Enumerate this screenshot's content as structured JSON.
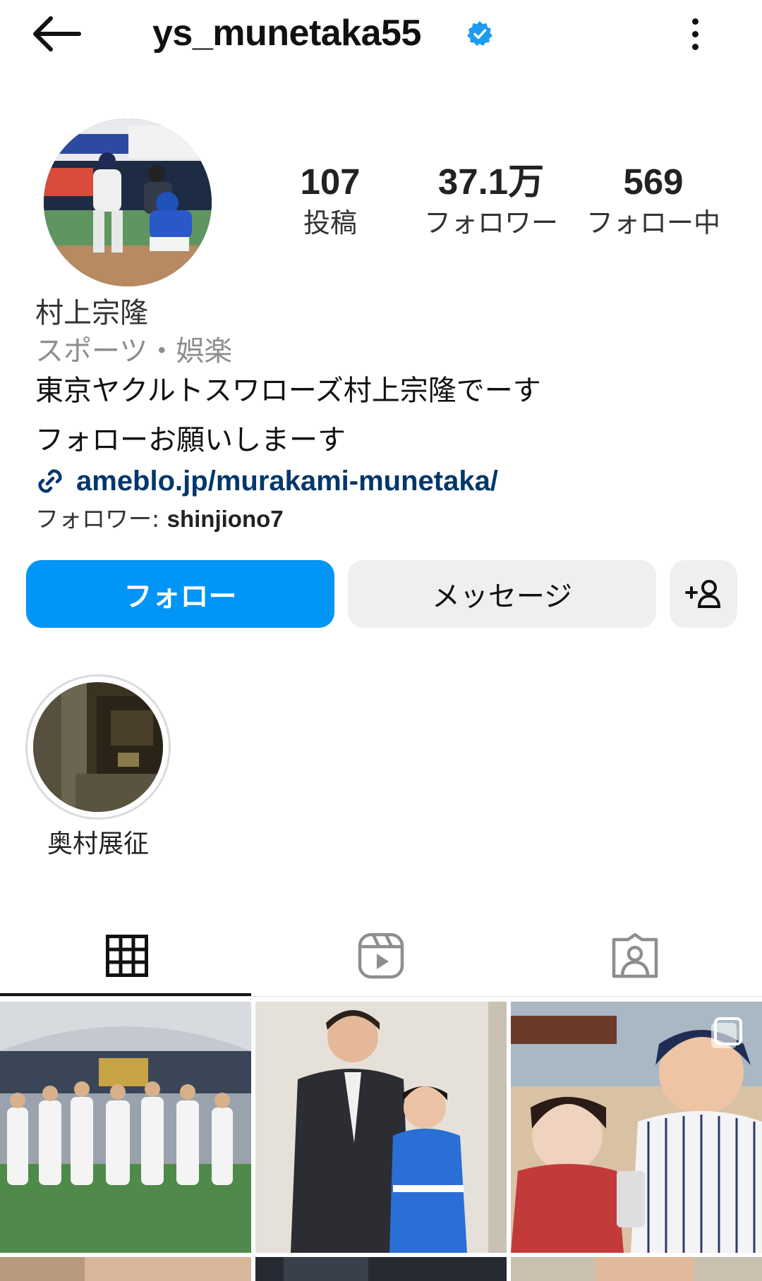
{
  "header": {
    "username": "ys_munetaka55"
  },
  "stats": [
    {
      "value": "107",
      "label": "投稿"
    },
    {
      "value": "37.1万",
      "label": "フォロワー"
    },
    {
      "value": "569",
      "label": "フォロー中"
    }
  ],
  "profile": {
    "name": "村上宗隆",
    "category": "スポーツ・娯楽",
    "bio_line1": "東京ヤクルトスワローズ村上宗隆でーす",
    "bio_line2": "フォローお願いしまーす",
    "link": "ameblo.jp/murakami-munetaka/",
    "followed_by_prefix": "フォロワー: ",
    "followed_by_user": "shinjiono7"
  },
  "actions": {
    "follow_label": "フォロー",
    "message_label": "メッセージ"
  },
  "highlights": [
    {
      "label": "奥村展征"
    }
  ],
  "tabs": [
    {
      "name": "posts",
      "icon": "grid-icon",
      "active": true
    },
    {
      "name": "reels",
      "icon": "reels-icon",
      "active": false
    },
    {
      "name": "tagged",
      "icon": "tagged-user-icon",
      "active": false
    }
  ],
  "colors": {
    "follow_button": "#0095f6",
    "link": "#00376b",
    "verified": "#1d9bf0",
    "secondary_button": "#efefef"
  }
}
